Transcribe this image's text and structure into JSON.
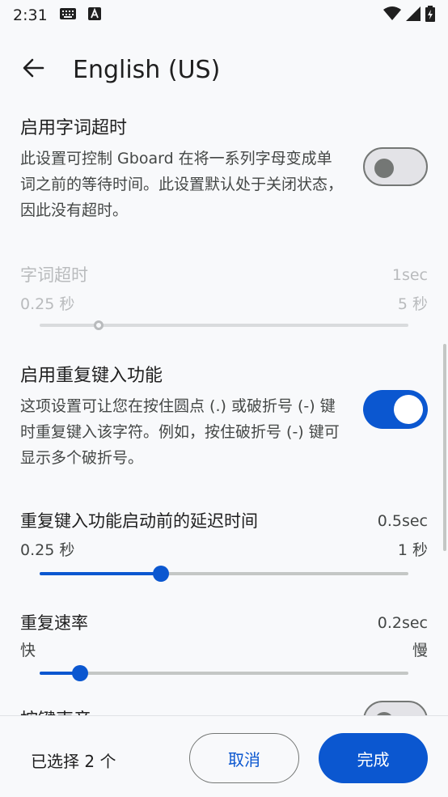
{
  "status_bar": {
    "time": "2:31"
  },
  "app_bar": {
    "title": "English (US)"
  },
  "settings": {
    "word_timeout_toggle": {
      "title": "启用字词超时",
      "description": "此设置可控制 Gboard 在将一系列字母变成单词之前的等待时间。此设置默认处于关闭状态，因此没有超时。",
      "state": "off"
    },
    "word_timeout_slider": {
      "label": "字词超时",
      "value": "1sec",
      "min_label": "0.25 秒",
      "max_label": "5 秒",
      "position_fraction": 0.16,
      "enabled": false
    },
    "key_repeat_toggle": {
      "title": "启用重复键入功能",
      "description": "这项设置可让您在按住圆点 (.) 或破折号 (-) 键时重复键入该字符。例如，按住破折号 (-) 键可显示多个破折号。",
      "state": "on"
    },
    "repeat_delay_slider": {
      "label": "重复键入功能启动前的延迟时间",
      "value": "0.5sec",
      "min_label": "0.25 秒",
      "max_label": "1 秒",
      "position_fraction": 0.33
    },
    "repeat_rate_slider": {
      "label": "重复速率",
      "value": "0.2sec",
      "min_label": "快",
      "max_label": "慢",
      "position_fraction": 0.11
    },
    "partial_next": {
      "title": "按键声音"
    }
  },
  "bottom_bar": {
    "selected_count": "已选择 2 个",
    "cancel_label": "取消",
    "done_label": "完成"
  },
  "colors": {
    "accent": "#0b57d0",
    "background": "#f8f9fb"
  }
}
